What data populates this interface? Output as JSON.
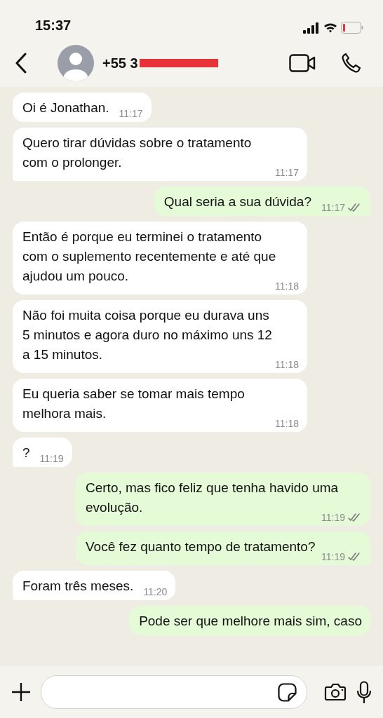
{
  "status_bar": {
    "time": "15:37"
  },
  "header": {
    "contact": "+55 3",
    "redacted": true
  },
  "messages": [
    {
      "kind": "incoming",
      "text": "Oi é Jonathan.",
      "time": "11:17",
      "tail": false
    },
    {
      "kind": "incoming",
      "text": "Quero tirar dúvidas sobre o tratamento com o prolonger.",
      "time": "11:17",
      "tail": true
    },
    {
      "kind": "outgoing",
      "text": "Qual seria a sua dúvida?",
      "time": "11:17",
      "tail": true,
      "delivered": true
    },
    {
      "kind": "incoming",
      "text": "Então é porque eu terminei o tratamento com o suplemento recentemente e até que ajudou um pouco.",
      "time": "11:18",
      "tail": false
    },
    {
      "kind": "incoming",
      "text": "Não foi muita coisa porque eu durava uns 5 minutos e agora duro no máximo uns 12 a 15 minutos.",
      "time": "11:18",
      "tail": false
    },
    {
      "kind": "incoming",
      "text": "Eu queria saber se tomar mais tempo melhora mais.",
      "time": "11:18",
      "tail": false
    },
    {
      "kind": "incoming",
      "text": "?",
      "time": "11:19",
      "tail": true
    },
    {
      "kind": "outgoing",
      "text": "Certo, mas fico feliz que tenha havido uma evolução.",
      "time": "11:19",
      "tail": false,
      "delivered": true
    },
    {
      "kind": "outgoing",
      "text": "Você fez quanto tempo de tratamento?",
      "time": "11:19",
      "tail": true,
      "delivered": true
    },
    {
      "kind": "incoming",
      "text": "Foram três meses.",
      "time": "11:20",
      "tail": true
    },
    {
      "kind": "outgoing",
      "text": "Pode ser que melhore mais sim, caso",
      "tail": false
    }
  ]
}
